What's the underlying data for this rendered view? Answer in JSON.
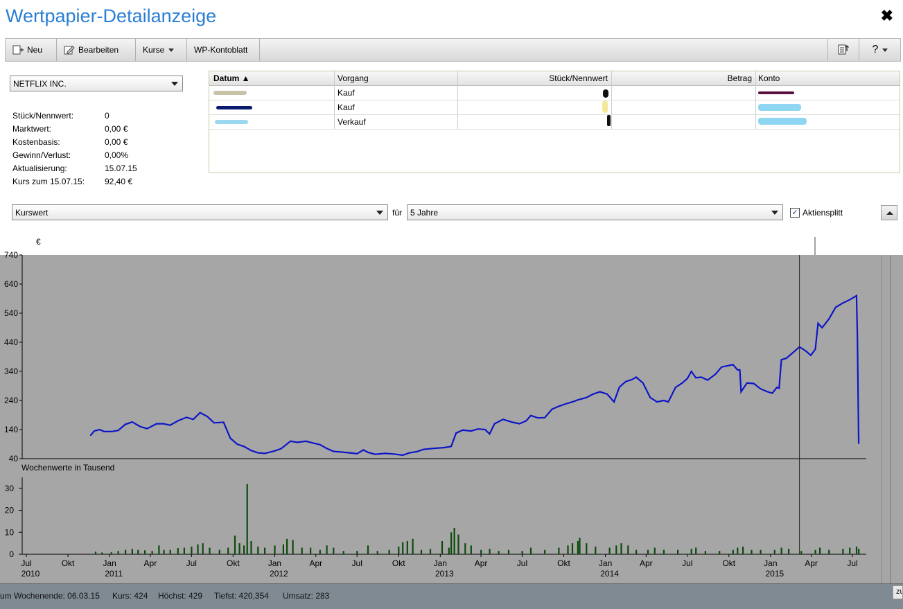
{
  "window": {
    "title": "Wertpapier-Detailanzeige",
    "close_glyph": "✖"
  },
  "toolbar": {
    "neu": "Neu",
    "bearbeiten": "Bearbeiten",
    "kurse": "Kurse",
    "kontoblatt": "WP-Kontoblatt",
    "help": "?"
  },
  "security": {
    "selected": "NETFLIX INC.",
    "fields": [
      {
        "label": "Stück/Nennwert:",
        "value": "0"
      },
      {
        "label": "Marktwert:",
        "value": "0,00 €"
      },
      {
        "label": "Kostenbasis:",
        "value": "0,00 €"
      },
      {
        "label": "Gewinn/Verlust:",
        "value": "0,00%"
      },
      {
        "label": "Aktualisierung:",
        "value": "15.07.15"
      },
      {
        "label": "Kurs zum 15.07.15:",
        "value": "92,40 €"
      }
    ]
  },
  "transactions": {
    "columns": [
      "Datum ▲",
      "Vorgang",
      "Stück/Nennwert",
      "Betrag",
      "Konto"
    ],
    "rows": [
      {
        "vorgang": "Kauf"
      },
      {
        "vorgang": "Kauf"
      },
      {
        "vorgang": "Verkauf"
      }
    ]
  },
  "chart_controls": {
    "metric": "Kurswert",
    "fuer_label": "für",
    "period": "5 Jahre",
    "split_label": "Aktiensplitt",
    "split_checked": "✓"
  },
  "chart_data": {
    "type": "line",
    "currency_label": "€",
    "y_ticks": [
      40,
      140,
      240,
      340,
      440,
      540,
      640,
      740
    ],
    "ylim": [
      40,
      740
    ],
    "x_range": [
      "2010-07",
      "2015-07"
    ],
    "month_ticks": [
      {
        "date": "2010-07",
        "label": "Jul",
        "year": "2010"
      },
      {
        "date": "2010-10",
        "label": "Okt"
      },
      {
        "date": "2011-01",
        "label": "Jan",
        "year": "2011"
      },
      {
        "date": "2011-04",
        "label": "Apr"
      },
      {
        "date": "2011-07",
        "label": "Jul"
      },
      {
        "date": "2011-10",
        "label": "Okt"
      },
      {
        "date": "2012-01",
        "label": "Jan",
        "year": "2012"
      },
      {
        "date": "2012-04",
        "label": "Apr"
      },
      {
        "date": "2012-07",
        "label": "Jul"
      },
      {
        "date": "2012-10",
        "label": "Okt"
      },
      {
        "date": "2013-01",
        "label": "Jan",
        "year": "2013"
      },
      {
        "date": "2013-04",
        "label": "Apr"
      },
      {
        "date": "2013-07",
        "label": "Jul"
      },
      {
        "date": "2013-10",
        "label": "Okt"
      },
      {
        "date": "2014-01",
        "label": "Jan",
        "year": "2014"
      },
      {
        "date": "2014-04",
        "label": "Apr"
      },
      {
        "date": "2014-07",
        "label": "Jul"
      },
      {
        "date": "2014-10",
        "label": "Okt"
      },
      {
        "date": "2015-01",
        "label": "Jan",
        "year": "2015"
      },
      {
        "date": "2015-04",
        "label": "Apr"
      },
      {
        "date": "2015-07",
        "label": "Jul"
      }
    ],
    "price_series": [
      [
        "2010-11-20",
        120
      ],
      [
        "2010-11-28",
        135
      ],
      [
        "2010-12-10",
        140
      ],
      [
        "2010-12-20",
        133
      ],
      [
        "2011-01-05",
        133
      ],
      [
        "2011-01-20",
        137
      ],
      [
        "2011-02-05",
        158
      ],
      [
        "2011-02-20",
        166
      ],
      [
        "2011-03-10",
        150
      ],
      [
        "2011-03-25",
        143
      ],
      [
        "2011-04-15",
        160
      ],
      [
        "2011-04-30",
        160
      ],
      [
        "2011-05-15",
        155
      ],
      [
        "2011-06-01",
        170
      ],
      [
        "2011-06-20",
        182
      ],
      [
        "2011-07-05",
        175
      ],
      [
        "2011-07-20",
        198
      ],
      [
        "2011-08-05",
        185
      ],
      [
        "2011-08-20",
        163
      ],
      [
        "2011-09-10",
        165
      ],
      [
        "2011-09-25",
        110
      ],
      [
        "2011-10-10",
        90
      ],
      [
        "2011-10-25",
        82
      ],
      [
        "2011-11-10",
        68
      ],
      [
        "2011-11-25",
        60
      ],
      [
        "2011-12-10",
        58
      ],
      [
        "2011-12-31",
        66
      ],
      [
        "2012-01-15",
        74
      ],
      [
        "2012-02-05",
        100
      ],
      [
        "2012-02-20",
        96
      ],
      [
        "2012-03-10",
        100
      ],
      [
        "2012-03-25",
        94
      ],
      [
        "2012-04-10",
        88
      ],
      [
        "2012-04-25",
        75
      ],
      [
        "2012-05-10",
        65
      ],
      [
        "2012-05-25",
        63
      ],
      [
        "2012-06-15",
        60
      ],
      [
        "2012-07-01",
        57
      ],
      [
        "2012-07-15",
        70
      ],
      [
        "2012-07-25",
        62
      ],
      [
        "2012-08-10",
        55
      ],
      [
        "2012-09-01",
        58
      ],
      [
        "2012-09-20",
        56
      ],
      [
        "2012-10-10",
        52
      ],
      [
        "2012-10-25",
        60
      ],
      [
        "2012-11-10",
        64
      ],
      [
        "2012-11-25",
        72
      ],
      [
        "2012-12-15",
        75
      ],
      [
        "2013-01-10",
        78
      ],
      [
        "2013-01-25",
        82
      ],
      [
        "2013-02-05",
        128
      ],
      [
        "2013-02-20",
        138
      ],
      [
        "2013-03-10",
        135
      ],
      [
        "2013-03-25",
        142
      ],
      [
        "2013-04-10",
        140
      ],
      [
        "2013-04-20",
        125
      ],
      [
        "2013-05-01",
        160
      ],
      [
        "2013-05-20",
        175
      ],
      [
        "2013-06-10",
        165
      ],
      [
        "2013-06-25",
        160
      ],
      [
        "2013-07-10",
        170
      ],
      [
        "2013-07-20",
        188
      ],
      [
        "2013-08-05",
        180
      ],
      [
        "2013-08-20",
        181
      ],
      [
        "2013-09-05",
        210
      ],
      [
        "2013-09-20",
        220
      ],
      [
        "2013-10-05",
        228
      ],
      [
        "2013-10-20",
        235
      ],
      [
        "2013-11-01",
        242
      ],
      [
        "2013-11-20",
        250
      ],
      [
        "2013-12-05",
        262
      ],
      [
        "2013-12-20",
        270
      ],
      [
        "2014-01-05",
        262
      ],
      [
        "2014-01-20",
        235
      ],
      [
        "2014-02-01",
        286
      ],
      [
        "2014-02-15",
        305
      ],
      [
        "2014-03-01",
        312
      ],
      [
        "2014-03-10",
        320
      ],
      [
        "2014-03-25",
        300
      ],
      [
        "2014-04-10",
        250
      ],
      [
        "2014-04-25",
        235
      ],
      [
        "2014-05-10",
        240
      ],
      [
        "2014-05-20",
        235
      ],
      [
        "2014-06-05",
        285
      ],
      [
        "2014-06-20",
        300
      ],
      [
        "2014-07-01",
        315
      ],
      [
        "2014-07-10",
        340
      ],
      [
        "2014-07-20",
        318
      ],
      [
        "2014-08-01",
        320
      ],
      [
        "2014-08-15",
        310
      ],
      [
        "2014-09-01",
        330
      ],
      [
        "2014-09-15",
        355
      ],
      [
        "2014-10-01",
        360
      ],
      [
        "2014-10-10",
        363
      ],
      [
        "2014-10-20",
        345
      ],
      [
        "2014-10-25",
        345
      ],
      [
        "2014-10-28",
        270
      ],
      [
        "2014-11-10",
        300
      ],
      [
        "2014-11-25",
        298
      ],
      [
        "2014-12-10",
        280
      ],
      [
        "2014-12-25",
        270
      ],
      [
        "2015-01-05",
        265
      ],
      [
        "2015-01-15",
        285
      ],
      [
        "2015-01-20",
        282
      ],
      [
        "2015-01-25",
        380
      ],
      [
        "2015-02-05",
        385
      ],
      [
        "2015-02-20",
        405
      ],
      [
        "2015-03-06",
        424
      ],
      [
        "2015-03-20",
        410
      ],
      [
        "2015-03-31",
        395
      ],
      [
        "2015-04-10",
        416
      ],
      [
        "2015-04-16",
        505
      ],
      [
        "2015-04-25",
        490
      ],
      [
        "2015-05-10",
        520
      ],
      [
        "2015-05-25",
        560
      ],
      [
        "2015-06-10",
        575
      ],
      [
        "2015-06-25",
        586
      ],
      [
        "2015-07-10",
        600
      ],
      [
        "2015-07-12",
        460
      ],
      [
        "2015-07-14",
        200
      ],
      [
        "2015-07-15",
        92
      ]
    ],
    "volume_label": "Wochenwerte in Tausend",
    "volume_ticks": [
      0,
      10,
      20,
      30
    ],
    "volume_series": [
      [
        "2010-12-01",
        1.2
      ],
      [
        "2010-12-15",
        0.8
      ],
      [
        "2011-01-05",
        0.9
      ],
      [
        "2011-01-20",
        1.5
      ],
      [
        "2011-02-05",
        2
      ],
      [
        "2011-02-20",
        2.5
      ],
      [
        "2011-03-05",
        2
      ],
      [
        "2011-03-20",
        1.8
      ],
      [
        "2011-04-05",
        1.5
      ],
      [
        "2011-04-20",
        4
      ],
      [
        "2011-05-01",
        2
      ],
      [
        "2011-05-15",
        2
      ],
      [
        "2011-06-01",
        2.8
      ],
      [
        "2011-06-15",
        3
      ],
      [
        "2011-07-01",
        3.5
      ],
      [
        "2011-07-15",
        4.5
      ],
      [
        "2011-07-26",
        5
      ],
      [
        "2011-08-10",
        3
      ],
      [
        "2011-09-01",
        2
      ],
      [
        "2011-09-20",
        3
      ],
      [
        "2011-10-05",
        8.5
      ],
      [
        "2011-10-15",
        5
      ],
      [
        "2011-10-25",
        4
      ],
      [
        "2011-11-01",
        32
      ],
      [
        "2011-11-10",
        6
      ],
      [
        "2011-11-25",
        3.5
      ],
      [
        "2011-12-10",
        3
      ],
      [
        "2012-01-01",
        4
      ],
      [
        "2012-01-20",
        4.5
      ],
      [
        "2012-01-28",
        7
      ],
      [
        "2012-02-10",
        6.5
      ],
      [
        "2012-03-01",
        3
      ],
      [
        "2012-03-20",
        3
      ],
      [
        "2012-04-10",
        2
      ],
      [
        "2012-04-25",
        4
      ],
      [
        "2012-05-10",
        3
      ],
      [
        "2012-06-01",
        1.5
      ],
      [
        "2012-07-01",
        1.5
      ],
      [
        "2012-07-25",
        4
      ],
      [
        "2012-08-15",
        1.5
      ],
      [
        "2012-09-10",
        2
      ],
      [
        "2012-10-01",
        3.5
      ],
      [
        "2012-10-10",
        5.5
      ],
      [
        "2012-10-20",
        6
      ],
      [
        "2012-11-01",
        7
      ],
      [
        "2012-11-20",
        2
      ],
      [
        "2012-12-10",
        2.5
      ],
      [
        "2013-01-05",
        6
      ],
      [
        "2013-01-20",
        3
      ],
      [
        "2013-01-25",
        10
      ],
      [
        "2013-02-01",
        12
      ],
      [
        "2013-02-10",
        9
      ],
      [
        "2013-02-25",
        5
      ],
      [
        "2013-03-10",
        4
      ],
      [
        "2013-04-01",
        2
      ],
      [
        "2013-04-20",
        2.5
      ],
      [
        "2013-05-10",
        1.5
      ],
      [
        "2013-06-01",
        2
      ],
      [
        "2013-07-01",
        1.5
      ],
      [
        "2013-07-20",
        3
      ],
      [
        "2013-08-20",
        2
      ],
      [
        "2013-09-20",
        3
      ],
      [
        "2013-10-10",
        4
      ],
      [
        "2013-10-20",
        5
      ],
      [
        "2013-11-01",
        6
      ],
      [
        "2013-11-05",
        7.5
      ],
      [
        "2013-11-20",
        5
      ],
      [
        "2013-12-10",
        3.5
      ],
      [
        "2014-01-10",
        3
      ],
      [
        "2014-01-25",
        4
      ],
      [
        "2014-02-05",
        5
      ],
      [
        "2014-02-20",
        4
      ],
      [
        "2014-03-10",
        2
      ],
      [
        "2014-04-05",
        2
      ],
      [
        "2014-04-20",
        3
      ],
      [
        "2014-05-10",
        2
      ],
      [
        "2014-06-10",
        2
      ],
      [
        "2014-07-10",
        2.5
      ],
      [
        "2014-07-20",
        3
      ],
      [
        "2014-08-10",
        1.5
      ],
      [
        "2014-09-10",
        1.5
      ],
      [
        "2014-10-10",
        2
      ],
      [
        "2014-10-20",
        3
      ],
      [
        "2014-11-01",
        3.5
      ],
      [
        "2014-11-20",
        2
      ],
      [
        "2014-12-10",
        2
      ],
      [
        "2015-01-10",
        2
      ],
      [
        "2015-01-25",
        3
      ],
      [
        "2015-02-10",
        2.5
      ],
      [
        "2015-03-10",
        1.5
      ],
      [
        "2015-04-10",
        2
      ],
      [
        "2015-04-20",
        3
      ],
      [
        "2015-05-10",
        2
      ],
      [
        "2015-06-10",
        2.5
      ],
      [
        "2015-06-25",
        3
      ],
      [
        "2015-07-10",
        3.5
      ],
      [
        "2015-07-15",
        2.5
      ]
    ],
    "cursor_date": "2015-03-06",
    "legend": "none",
    "grid": false
  },
  "status": {
    "week": "um Wochenende: 06.03.15",
    "kurs": "Kurs: 424",
    "hoechst": "Höchst: 429",
    "tiefst": "Tiefst: 420,354",
    "umsatz": "Umsatz: 283",
    "side_button": "zu"
  }
}
